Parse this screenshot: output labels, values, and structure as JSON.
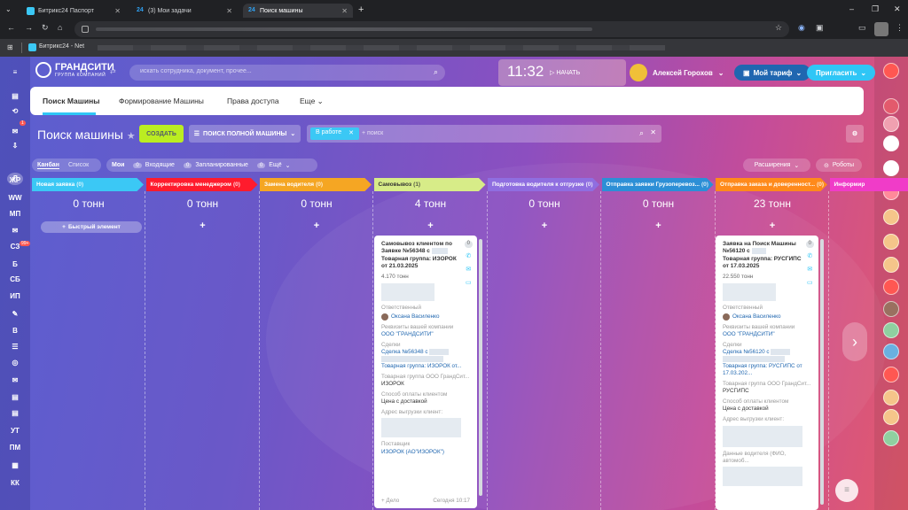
{
  "browser": {
    "tabs": [
      {
        "label": "Битрикс24 Паспорт",
        "color": "#3bc8f5"
      },
      {
        "label": "(3) Мои задачи",
        "color": "#2fa0f0"
      },
      {
        "label": "Поиск машины",
        "color": "#2fa0f0"
      }
    ],
    "new_tab": "+",
    "bookmark": "Битрикс24 - Net"
  },
  "header": {
    "logo_name": "ГРАНДСИТИ",
    "logo_sub": "ГРУППА КОМПАНИЙ",
    "search_placeholder": "искать сотрудника, документ, прочее...",
    "clock": "11:32",
    "start_label": "НАЧАТЬ",
    "user_name": "Алексей Горохов",
    "tariff_label": "Мой тариф",
    "invite_label": "Пригласить"
  },
  "nav": {
    "tabs": [
      "Поиск Машины",
      "Формирование Машины",
      "Права доступа",
      "Еще"
    ]
  },
  "toolbar": {
    "title": "Поиск машины",
    "create_label": "СОЗДАТЬ",
    "search_full_label": "ПОИСК ПОЛНОЙ МАШИНЫ",
    "filter_tag": "В работе",
    "filter_placeholder": "+ поиск"
  },
  "subbar": {
    "view_kanban": "Канбан",
    "view_list": "Список",
    "my": "Мои",
    "incoming": "Входящие",
    "incoming_count": "0",
    "planned": "Запланированные",
    "planned_count": "0",
    "more": "Ещё",
    "more_count": "0",
    "extensions": "Расширения",
    "robots": "Роботы"
  },
  "left_menu": [
    "≡",
    "▤",
    "⟲",
    "✉",
    "⇩",
    "Л",
    "ЖР",
    "WW",
    "МП",
    "✉",
    "СЗ",
    "Б",
    "СБ",
    "ИП",
    "✎",
    "В",
    "☰",
    "◎",
    "✉",
    "▤",
    "▤",
    "УТ",
    "ПМ",
    "▦",
    "КК"
  ],
  "left_badges": {
    "filter": "1",
    "mail": "99+"
  },
  "columns": [
    {
      "name": "Новая заявка",
      "count": "(0)",
      "color": "#3bc8f5",
      "sum": "0 тонн"
    },
    {
      "name": "Корректировка менеджером",
      "count": "(0)",
      "color": "#ff1b2d",
      "sum": "0 тонн"
    },
    {
      "name": "Замена водителя",
      "count": "(0)",
      "color": "#f5a623",
      "sum": "0 тонн"
    },
    {
      "name": "Самовывоз",
      "count": "(1)",
      "color": "#d7ec88",
      "sum": "4 тонн"
    },
    {
      "name": "Подготовка водителя к отгрузке",
      "count": "(0)",
      "color": "#8f6ee0",
      "sum": "0 тонн"
    },
    {
      "name": "Отправка заявки Грузоперевоз...",
      "count": "(0)",
      "color": "#2c8fd6",
      "sum": "0 тонн"
    },
    {
      "name": "Отправка заказа и доверенност...",
      "count": "(0)",
      "color": "#ff8a1b",
      "sum": "23 тонн"
    },
    {
      "name": "Информир",
      "count": "",
      "color": "#f03cc8",
      "sum": ""
    }
  ],
  "quick_add": "Быстрый элемент",
  "cards": [
    {
      "title": "Самовывоз клиентом по Заявке №56348 с",
      "goods": "Товарная группа: ИЗОРОК от 21.03.2025",
      "weight": "4.170 тонн",
      "resp_label": "Ответственный",
      "resp": "Оксана Василенко",
      "req_label": "Реквизиты вашей компании",
      "req": "ООО \"ГРАНДСИТИ\"",
      "deals_label": "Сделки",
      "deal1": "Сделка №56348 с",
      "deal2": "Товарная группа: ИЗОРОК от...",
      "tg_label": "Товарная группа ООО ГрандСит...",
      "tg": "ИЗОРОК",
      "pay_label": "Способ оплаты клиентом",
      "pay": "Цена с доставкой",
      "addr_label": "Адрес выгрузки клиент:",
      "supplier_label": "Поставщик",
      "supplier": "ИЗОРОК (АО\"ИЗОРОК\")",
      "foot_left": "+ Дело",
      "foot_right": "Сегодня 10:17",
      "zero": "0"
    },
    {
      "title": "Заявка на Поиск Машины №56120 с",
      "goods": "Товарная группа: РУСГИПС от 17.03.2025",
      "weight": "22.550 тонн",
      "resp_label": "Ответственный",
      "resp": "Оксана Василенко",
      "req_label": "Реквизиты вашей компании",
      "req": "ООО \"ГРАНДСИТИ\"",
      "deals_label": "Сделки",
      "deal1": "Сделка №56120 с",
      "deal2": "Товарная группа: РУСГИПС от 17.03.202...",
      "tg_label": "Товарная группа ООО ГрандСит...",
      "tg": "РУСГИПС",
      "pay_label": "Способ оплаты клиентом",
      "pay": "Цена с доставкой",
      "addr_label": "Адрес выгрузки клиент:",
      "driver_label": "Данные водителя (ФИО, автомоб...",
      "zero": "0"
    }
  ]
}
